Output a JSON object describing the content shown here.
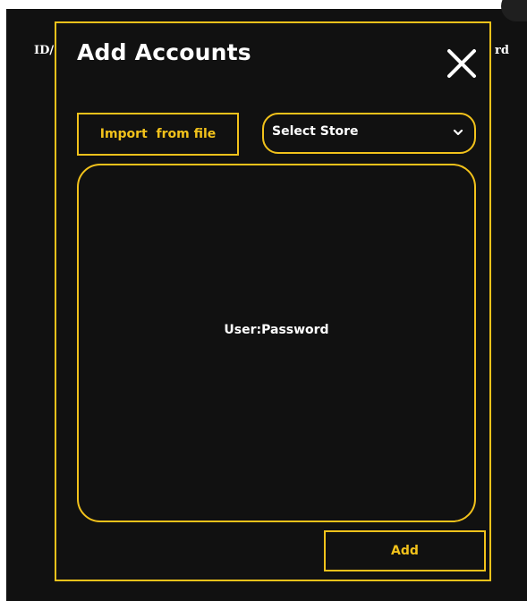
{
  "background": {
    "left_label": "ID/",
    "right_label": "rd"
  },
  "modal": {
    "title": "Add Accounts",
    "close_icon": "close-icon",
    "import_button_label": "Import  from file",
    "store_select": {
      "selected": "Select Store",
      "icon": "chevron-down-icon"
    },
    "accounts_placeholder": "User:Password",
    "add_button_label": "Add"
  },
  "colors": {
    "accent": "#f2c21b",
    "background": "#111111",
    "text": "#ffffff"
  }
}
